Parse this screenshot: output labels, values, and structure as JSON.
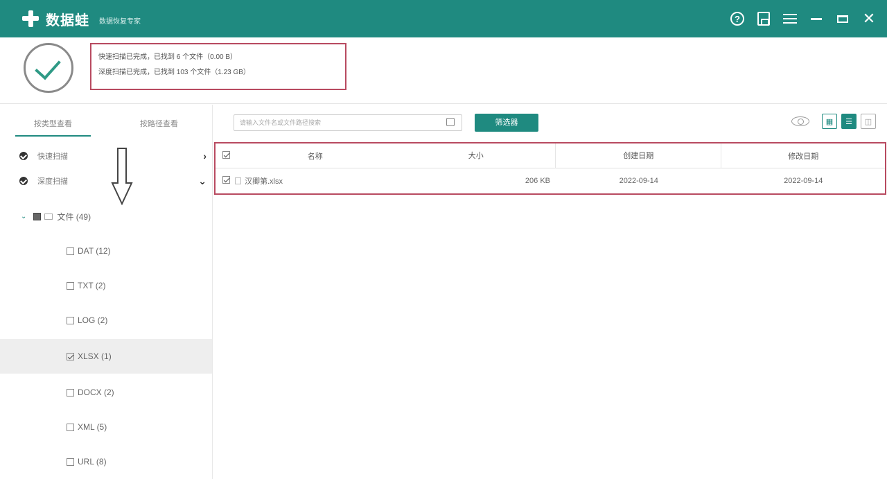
{
  "app": {
    "name": "数据蛙",
    "slogan": "数据恢复专家"
  },
  "window_controls": [
    "help-icon",
    "save-icon",
    "menu-icon",
    "minimize-icon",
    "maximize-icon",
    "close-icon"
  ],
  "status": {
    "line1": "快速扫描已完成，已找到 6 个文件（0.00 B）",
    "line2": "深度扫描已完成，已找到 103 个文件（1.23 GB）"
  },
  "left_tabs": [
    {
      "label": "按类型查看",
      "active": true
    },
    {
      "label": "按路径查看",
      "active": false
    }
  ],
  "scan_groups": [
    {
      "label": "快速扫描",
      "chevron": "›"
    },
    {
      "label": "深度扫描",
      "chevron": "⌄"
    }
  ],
  "tree": {
    "root": "文件 (49)",
    "children": [
      {
        "label": "DAT (12)",
        "checked": false
      },
      {
        "label": "TXT (2)",
        "checked": false
      },
      {
        "label": "LOG (2)",
        "checked": false
      },
      {
        "label": "XLSX (1)",
        "checked": true
      },
      {
        "label": "DOCX (2)",
        "checked": false
      },
      {
        "label": "XML (5)",
        "checked": false
      },
      {
        "label": "URL (8)",
        "checked": false
      }
    ]
  },
  "toolbar": {
    "search_placeholder": "请输入文件名或文件路径搜索",
    "filter_label": "筛选器"
  },
  "table": {
    "headers": {
      "name": "名称",
      "size": "大小",
      "created": "创建日期",
      "modified": "修改日期"
    },
    "rows": [
      {
        "name": "汉卿第.xlsx",
        "size": "206 KB",
        "created": "2022-09-14",
        "modified": "2022-09-14"
      }
    ]
  },
  "colors": {
    "brand": "#1f8a80",
    "highlight_border": "#b84a60"
  }
}
